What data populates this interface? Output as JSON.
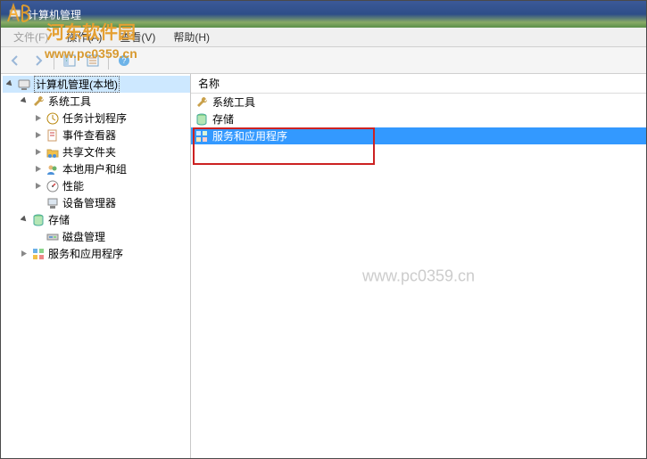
{
  "title": {
    "text": "计算机管理"
  },
  "menu": {
    "file": "文件(F)",
    "action": "操作(A)",
    "view": "查看(V)",
    "help": "帮助(H)"
  },
  "watermark": {
    "site_name": "河东软件园",
    "site_url": "www.pc0359.cn",
    "center": "www.pc0359.cn"
  },
  "tree": {
    "root": {
      "label": "计算机管理(本地)"
    },
    "system_tools": {
      "label": "系统工具",
      "children": {
        "task_scheduler": "任务计划程序",
        "event_viewer": "事件查看器",
        "shared_folders": "共享文件夹",
        "local_users": "本地用户和组",
        "performance": "性能",
        "device_manager": "设备管理器"
      }
    },
    "storage": {
      "label": "存储",
      "children": {
        "disk_management": "磁盘管理"
      }
    },
    "services_apps": {
      "label": "服务和应用程序"
    }
  },
  "list": {
    "header_name": "名称",
    "items": {
      "system_tools": "系统工具",
      "storage": "存储",
      "services_apps": "服务和应用程序"
    }
  }
}
